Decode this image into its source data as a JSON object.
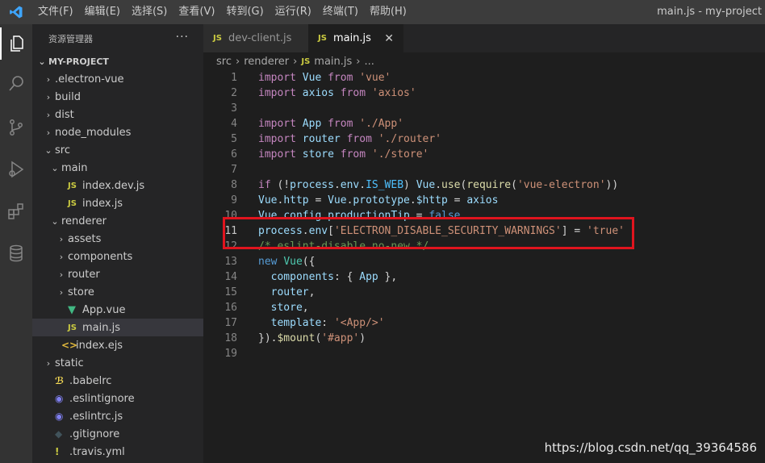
{
  "titlebar": {
    "menu": [
      "文件(F)",
      "编辑(E)",
      "选择(S)",
      "查看(V)",
      "转到(G)",
      "运行(R)",
      "终端(T)",
      "帮助(H)"
    ],
    "window_title": "main.js - my-project"
  },
  "activity_bar": {
    "icons": [
      "explorer-icon",
      "search-icon",
      "source-control-icon",
      "run-debug-icon",
      "extensions-icon",
      "database-icon"
    ]
  },
  "sidebar": {
    "header": "资源管理器",
    "more": "···",
    "root": "MY-PROJECT",
    "items": [
      {
        "label": ".electron-vue",
        "type": "folder",
        "depth": 1
      },
      {
        "label": "build",
        "type": "folder",
        "depth": 1
      },
      {
        "label": "dist",
        "type": "folder",
        "depth": 1
      },
      {
        "label": "node_modules",
        "type": "folder",
        "depth": 1
      },
      {
        "label": "src",
        "type": "folder-open",
        "depth": 1
      },
      {
        "label": "main",
        "type": "folder-open",
        "depth": 2
      },
      {
        "label": "index.dev.js",
        "type": "js",
        "depth": 3
      },
      {
        "label": "index.js",
        "type": "js",
        "depth": 3
      },
      {
        "label": "renderer",
        "type": "folder-open",
        "depth": 2
      },
      {
        "label": "assets",
        "type": "folder",
        "depth": 3
      },
      {
        "label": "components",
        "type": "folder",
        "depth": 3
      },
      {
        "label": "router",
        "type": "folder",
        "depth": 3
      },
      {
        "label": "store",
        "type": "folder",
        "depth": 3
      },
      {
        "label": "App.vue",
        "type": "vue",
        "depth": 3
      },
      {
        "label": "main.js",
        "type": "js",
        "depth": 3,
        "selected": true
      },
      {
        "label": "index.ejs",
        "type": "ejs",
        "depth": 2
      },
      {
        "label": "static",
        "type": "folder",
        "depth": 1
      },
      {
        "label": ".babelrc",
        "type": "babel",
        "depth": 1
      },
      {
        "label": ".eslintignore",
        "type": "eslint",
        "depth": 1
      },
      {
        "label": ".eslintrc.js",
        "type": "eslint",
        "depth": 1
      },
      {
        "label": ".gitignore",
        "type": "git",
        "depth": 1
      },
      {
        "label": ".travis.yml",
        "type": "travis",
        "depth": 1
      }
    ]
  },
  "tabs": [
    {
      "label": "dev-client.js",
      "icon": "JS",
      "active": false
    },
    {
      "label": "main.js",
      "icon": "JS",
      "active": true,
      "close": "✕"
    }
  ],
  "breadcrumb": {
    "parts": [
      "src",
      "renderer",
      "main.js",
      "..."
    ],
    "sep": "›",
    "icon": "JS"
  },
  "editor": {
    "current_line": 11,
    "lines": [
      [
        [
          "kwc",
          "import"
        ],
        [
          "code",
          " "
        ],
        [
          "var",
          "Vue"
        ],
        [
          "code",
          " "
        ],
        [
          "kwc",
          "from"
        ],
        [
          "code",
          " "
        ],
        [
          "str",
          "'vue'"
        ]
      ],
      [
        [
          "kwc",
          "import"
        ],
        [
          "code",
          " "
        ],
        [
          "var",
          "axios"
        ],
        [
          "code",
          " "
        ],
        [
          "kwc",
          "from"
        ],
        [
          "code",
          " "
        ],
        [
          "str",
          "'axios'"
        ]
      ],
      [],
      [
        [
          "kwc",
          "import"
        ],
        [
          "code",
          " "
        ],
        [
          "var",
          "App"
        ],
        [
          "code",
          " "
        ],
        [
          "kwc",
          "from"
        ],
        [
          "code",
          " "
        ],
        [
          "str",
          "'./App'"
        ]
      ],
      [
        [
          "kwc",
          "import"
        ],
        [
          "code",
          " "
        ],
        [
          "var",
          "router"
        ],
        [
          "code",
          " "
        ],
        [
          "kwc",
          "from"
        ],
        [
          "code",
          " "
        ],
        [
          "str",
          "'./router'"
        ]
      ],
      [
        [
          "kwc",
          "import"
        ],
        [
          "code",
          " "
        ],
        [
          "var",
          "store"
        ],
        [
          "code",
          " "
        ],
        [
          "kwc",
          "from"
        ],
        [
          "code",
          " "
        ],
        [
          "str",
          "'./store'"
        ]
      ],
      [],
      [
        [
          "kwc",
          "if"
        ],
        [
          "code",
          " (!"
        ],
        [
          "var",
          "process"
        ],
        [
          "code",
          "."
        ],
        [
          "var",
          "env"
        ],
        [
          "code",
          "."
        ],
        [
          "const",
          "IS_WEB"
        ],
        [
          "code",
          ") "
        ],
        [
          "var",
          "Vue"
        ],
        [
          "code",
          "."
        ],
        [
          "fn",
          "use"
        ],
        [
          "code",
          "("
        ],
        [
          "fn",
          "require"
        ],
        [
          "code",
          "("
        ],
        [
          "str",
          "'vue-electron'"
        ],
        [
          "code",
          "))"
        ]
      ],
      [
        [
          "var",
          "Vue"
        ],
        [
          "code",
          "."
        ],
        [
          "var",
          "http"
        ],
        [
          "code",
          " = "
        ],
        [
          "var",
          "Vue"
        ],
        [
          "code",
          "."
        ],
        [
          "var",
          "prototype"
        ],
        [
          "code",
          "."
        ],
        [
          "var",
          "$http"
        ],
        [
          "code",
          " = "
        ],
        [
          "var",
          "axios"
        ]
      ],
      [
        [
          "var",
          "Vue"
        ],
        [
          "code",
          "."
        ],
        [
          "var",
          "config"
        ],
        [
          "code",
          "."
        ],
        [
          "var",
          "productionTip"
        ],
        [
          "code",
          " = "
        ],
        [
          "kw",
          "false"
        ]
      ],
      [
        [
          "var",
          "process"
        ],
        [
          "code",
          "."
        ],
        [
          "var",
          "env"
        ],
        [
          "code",
          "["
        ],
        [
          "str",
          "'ELECTRON_DISABLE_SECURITY_WARNINGS'"
        ],
        [
          "code",
          "] = "
        ],
        [
          "str",
          "'true'"
        ]
      ],
      [
        [
          "cmt",
          "/* eslint-disable no-new */"
        ]
      ],
      [
        [
          "kw",
          "new"
        ],
        [
          "code",
          " "
        ],
        [
          "cls",
          "Vue"
        ],
        [
          "code",
          "({"
        ]
      ],
      [
        [
          "code",
          "  "
        ],
        [
          "var",
          "components"
        ],
        [
          "code",
          ": { "
        ],
        [
          "var",
          "App"
        ],
        [
          "code",
          " },"
        ]
      ],
      [
        [
          "code",
          "  "
        ],
        [
          "var",
          "router"
        ],
        [
          "code",
          ","
        ]
      ],
      [
        [
          "code",
          "  "
        ],
        [
          "var",
          "store"
        ],
        [
          "code",
          ","
        ]
      ],
      [
        [
          "code",
          "  "
        ],
        [
          "var",
          "template"
        ],
        [
          "code",
          ": "
        ],
        [
          "str",
          "'<App/>'"
        ]
      ],
      [
        [
          "code",
          "})."
        ],
        [
          "fn",
          "$mount"
        ],
        [
          "code",
          "("
        ],
        [
          "str",
          "'#app'"
        ],
        [
          "code",
          ")"
        ]
      ],
      []
    ]
  },
  "watermark": "https://blog.csdn.net/qq_39364586",
  "colors": {
    "highlight_box": "#e0141e",
    "accent": "#007acc"
  }
}
